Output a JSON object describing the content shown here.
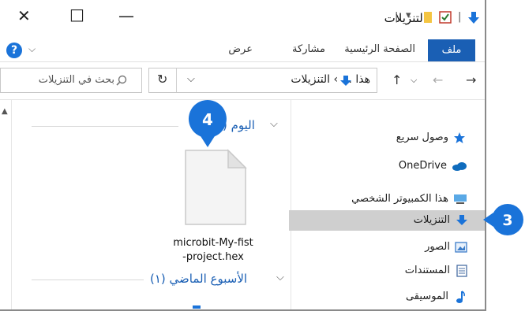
{
  "title_bar": {
    "title": "التنزيلات",
    "minimize_glyph": "—",
    "maximize_glyph": "□",
    "close_glyph": "✕"
  },
  "ribbon": {
    "file_tab": "ملف",
    "home_tab": "الصفحة الرئيسية",
    "share_tab": "مشاركة",
    "view_tab": "عرض",
    "help_glyph": "?"
  },
  "address": {
    "breadcrumb": "هذا ... › التنزيلات",
    "search_placeholder": "بحث في التنزيلات"
  },
  "content": {
    "group_today": "اليوم (",
    "group_last_week": "الأسبوع الماضي (١)",
    "file_name_line1": "microbit-My-fist",
    "file_name_line2": "-project.hex"
  },
  "nav_pane": {
    "items": [
      {
        "label": "وصول سريع",
        "icon": "star-icon"
      },
      {
        "label": "OneDrive",
        "icon": "cloud-icon"
      },
      {
        "label": "هذا الكمبيوتر الشخصي",
        "icon": "computer-icon"
      },
      {
        "label": "التنزيلات",
        "icon": "download-arrow-icon"
      },
      {
        "label": "الصور",
        "icon": "pictures-icon"
      },
      {
        "label": "المستندات",
        "icon": "documents-icon"
      },
      {
        "label": "الموسيقى",
        "icon": "music-icon"
      }
    ]
  },
  "callouts": {
    "badge_3": "3",
    "badge_4": "4"
  },
  "colors": {
    "accent": "#1a73d9",
    "ribbon_file": "#1a5fb4",
    "selected_row": "#cfcfcf"
  }
}
